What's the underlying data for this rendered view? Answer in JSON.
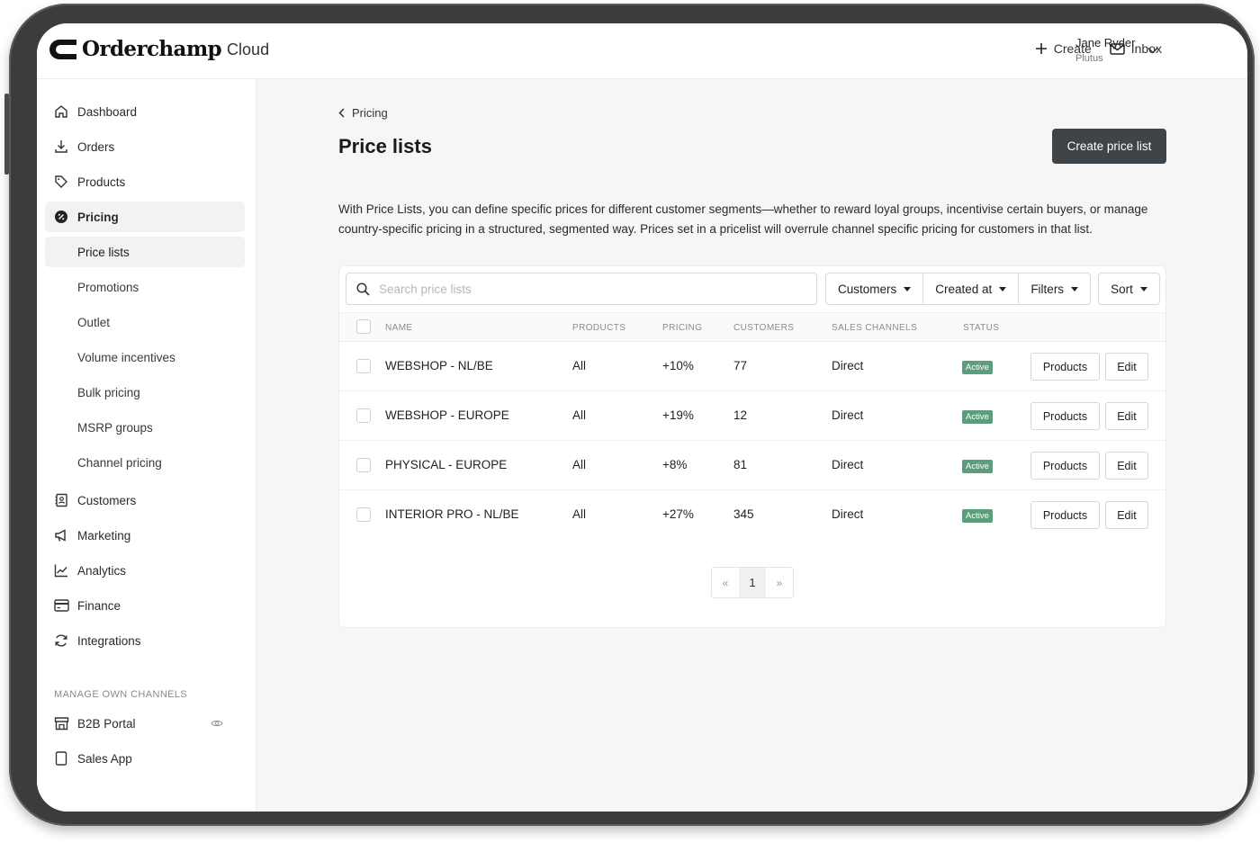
{
  "app": {
    "brand": "Orderchamp",
    "product": "Cloud"
  },
  "topbar": {
    "create_label": "Create",
    "inbox_label": "Inbox",
    "user_name": "Jane Ryder",
    "user_org": "Plutus"
  },
  "sidebar": {
    "items": [
      {
        "label": "Dashboard",
        "icon": "home-icon"
      },
      {
        "label": "Orders",
        "icon": "download-icon"
      },
      {
        "label": "Products",
        "icon": "tag-icon"
      },
      {
        "label": "Pricing",
        "icon": "percent-badge-icon"
      }
    ],
    "pricing_sub": [
      {
        "label": "Price lists"
      },
      {
        "label": "Promotions"
      },
      {
        "label": "Outlet"
      },
      {
        "label": "Volume incentives"
      },
      {
        "label": "Bulk pricing"
      },
      {
        "label": "MSRP groups"
      },
      {
        "label": "Channel pricing"
      }
    ],
    "items_after": [
      {
        "label": "Customers",
        "icon": "contact-book-icon"
      },
      {
        "label": "Marketing",
        "icon": "megaphone-icon"
      },
      {
        "label": "Analytics",
        "icon": "line-chart-icon"
      },
      {
        "label": "Finance",
        "icon": "credit-card-icon"
      },
      {
        "label": "Integrations",
        "icon": "refresh-icon"
      }
    ],
    "section_label": "MANAGE OWN CHANNELS",
    "channels": [
      {
        "label": "B2B Portal",
        "icon": "storefront-icon"
      },
      {
        "label": "Sales App",
        "icon": "tablet-icon"
      }
    ]
  },
  "main": {
    "breadcrumb": "Pricing",
    "title": "Price lists",
    "create_button": "Create price list",
    "description": "With Price Lists, you can define specific prices for different customer segments—whether to reward loyal groups, incentivise certain buyers, or manage country-specific pricing in a structured, segmented way. Prices set in a pricelist will overrule channel specific pricing for customers in that list."
  },
  "toolbar": {
    "search_placeholder": "Search price lists",
    "filters": [
      "Customers",
      "Created at",
      "Filters"
    ],
    "sort": "Sort"
  },
  "table": {
    "columns": [
      "NAME",
      "PRODUCTS",
      "PRICING",
      "CUSTOMERS",
      "SALES CHANNELS",
      "STATUS"
    ],
    "rows": [
      {
        "name": "WEBSHOP - NL/BE",
        "products": "All",
        "pricing": "+10%",
        "customers": "77",
        "channel": "Direct",
        "status": "Active",
        "btn_products": "Products",
        "btn_edit": "Edit"
      },
      {
        "name": "WEBSHOP - EUROPE",
        "products": "All",
        "pricing": "+19%",
        "customers": "12",
        "channel": "Direct",
        "status": "Active",
        "btn_products": "Products",
        "btn_edit": "Edit"
      },
      {
        "name": "PHYSICAL - EUROPE",
        "products": "All",
        "pricing": "+8%",
        "customers": "81",
        "channel": "Direct",
        "status": "Active",
        "btn_products": "Products",
        "btn_edit": "Edit"
      },
      {
        "name": "INTERIOR PRO - NL/BE",
        "products": "All",
        "pricing": "+27%",
        "customers": "345",
        "channel": "Direct",
        "status": "Active",
        "btn_products": "Products",
        "btn_edit": "Edit"
      }
    ]
  },
  "pagination": {
    "prev": "«",
    "current": "1",
    "next": "»"
  },
  "colors": {
    "primary_button": "#3e4448",
    "active_badge": "#5b9e7a",
    "device_frame": "#3c3c3e"
  }
}
